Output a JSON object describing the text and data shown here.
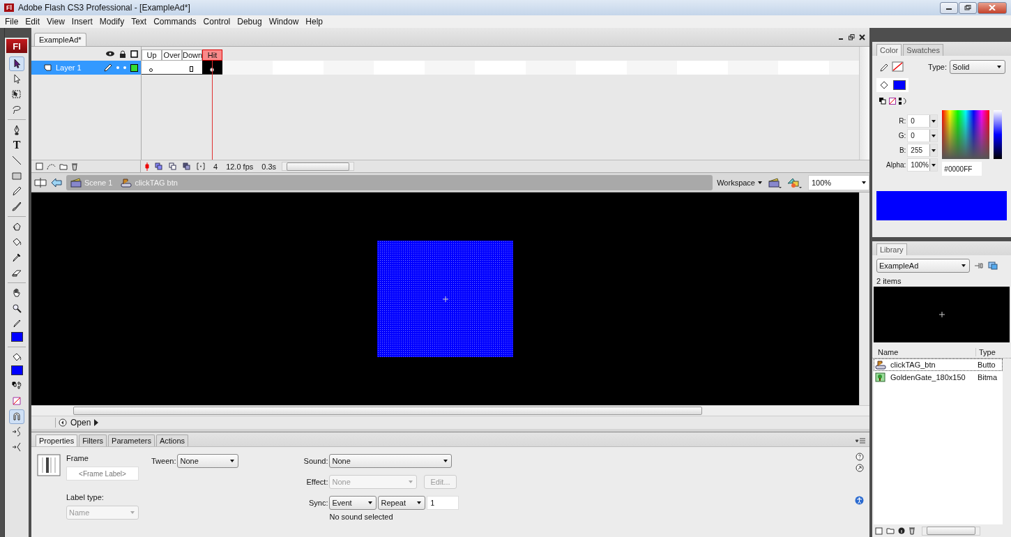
{
  "window": {
    "app_icon": "Fl",
    "title": "Adobe Flash CS3 Professional - [ExampleAd*]"
  },
  "menu": [
    "File",
    "Edit",
    "View",
    "Insert",
    "Modify",
    "Text",
    "Commands",
    "Control",
    "Debug",
    "Window",
    "Help"
  ],
  "toolbar": {
    "logo": "Fl",
    "tools": [
      {
        "kind": "selection",
        "selected": true
      },
      {
        "kind": "subselection",
        "selected": false
      },
      {
        "kind": "transform",
        "selected": false
      },
      {
        "kind": "lasso",
        "selected": false
      },
      {
        "kind": "sep"
      },
      {
        "kind": "pen",
        "selected": false
      },
      {
        "kind": "text",
        "glyph": "T",
        "selected": false
      },
      {
        "kind": "line",
        "selected": false
      },
      {
        "kind": "rect",
        "selected": false
      },
      {
        "kind": "pencil",
        "selected": false
      },
      {
        "kind": "brush",
        "selected": false
      },
      {
        "kind": "sep"
      },
      {
        "kind": "inkbottle",
        "selected": false
      },
      {
        "kind": "bucket",
        "selected": false
      },
      {
        "kind": "eyedropper",
        "selected": false
      },
      {
        "kind": "eraser",
        "selected": false
      },
      {
        "kind": "sep"
      },
      {
        "kind": "hand",
        "selected": false
      },
      {
        "kind": "zoom",
        "selected": false
      },
      {
        "kind": "strokepen",
        "selected": false
      },
      {
        "kind": "swatch",
        "color": "#0000ff"
      },
      {
        "kind": "sep"
      },
      {
        "kind": "fillbucket",
        "selected": false
      },
      {
        "kind": "swatch",
        "color": "#0000ff"
      },
      {
        "kind": "swapcolors",
        "selected": false
      },
      {
        "kind": "nocolor",
        "selected": false
      },
      {
        "kind": "snap",
        "selected": true
      },
      {
        "kind": "smooth",
        "selected": false
      },
      {
        "kind": "straighten",
        "selected": false
      }
    ]
  },
  "document": {
    "tab": "ExampleAd*"
  },
  "timeline": {
    "frames": [
      {
        "label": "Up",
        "selected": false,
        "kind": "blank_keyframe"
      },
      {
        "label": "Over",
        "selected": false,
        "kind": "empty"
      },
      {
        "label": "Down",
        "selected": false,
        "kind": "span_end"
      },
      {
        "label": "Hit",
        "selected": true,
        "kind": "keyframe"
      }
    ],
    "layers": [
      {
        "name": "Layer 1",
        "selected": true
      }
    ],
    "current_frame": "4",
    "frame_rate": "12.0 fps",
    "elapsed": "0.3s"
  },
  "edit_bar": {
    "crumbs": [
      {
        "kind": "scene",
        "label": "Scene 1"
      },
      {
        "kind": "button",
        "label": "clickTAG btn"
      }
    ],
    "workspace": "Workspace",
    "zoom": "100%"
  },
  "open_bar": {
    "label": "Open"
  },
  "properties": {
    "tabs": [
      {
        "label": "Properties",
        "selected": true
      },
      {
        "label": "Filters",
        "selected": false
      },
      {
        "label": "Parameters",
        "selected": false
      },
      {
        "label": "Actions",
        "selected": false
      }
    ],
    "frame_title": "Frame",
    "frame_label_placeholder": "<Frame Label>",
    "label_type_label": "Label type:",
    "label_type": "Name",
    "tween_label": "Tween:",
    "tween": "None",
    "sound_label": "Sound:",
    "sound": "None",
    "effect_label": "Effect:",
    "effect": "None",
    "edit_button": "Edit...",
    "sync_label": "Sync:",
    "sync": "Event",
    "repeat": "Repeat",
    "repeat_count": "1",
    "status": "No sound selected"
  },
  "color_panel": {
    "tabs": [
      {
        "label": "Color",
        "selected": true
      },
      {
        "label": "Swatches",
        "selected": false
      }
    ],
    "type_label": "Type:",
    "type": "Solid",
    "channels": [
      {
        "label": "R:",
        "value": "0"
      },
      {
        "label": "G:",
        "value": "0"
      },
      {
        "label": "B:",
        "value": "255"
      },
      {
        "label": "Alpha:",
        "value": "100%"
      }
    ],
    "hex": "#0000FF"
  },
  "library": {
    "tabs": [
      {
        "label": "Library",
        "selected": true
      }
    ],
    "document": "ExampleAd",
    "count": "2 items",
    "columns": [
      "Name",
      "Type"
    ],
    "items": [
      {
        "name": "clickTAG_btn",
        "type": "Butto",
        "kind": "button",
        "selected": true
      },
      {
        "name": "GoldenGate_180x150",
        "type": "Bitma",
        "kind": "bitmap",
        "selected": false
      }
    ]
  }
}
